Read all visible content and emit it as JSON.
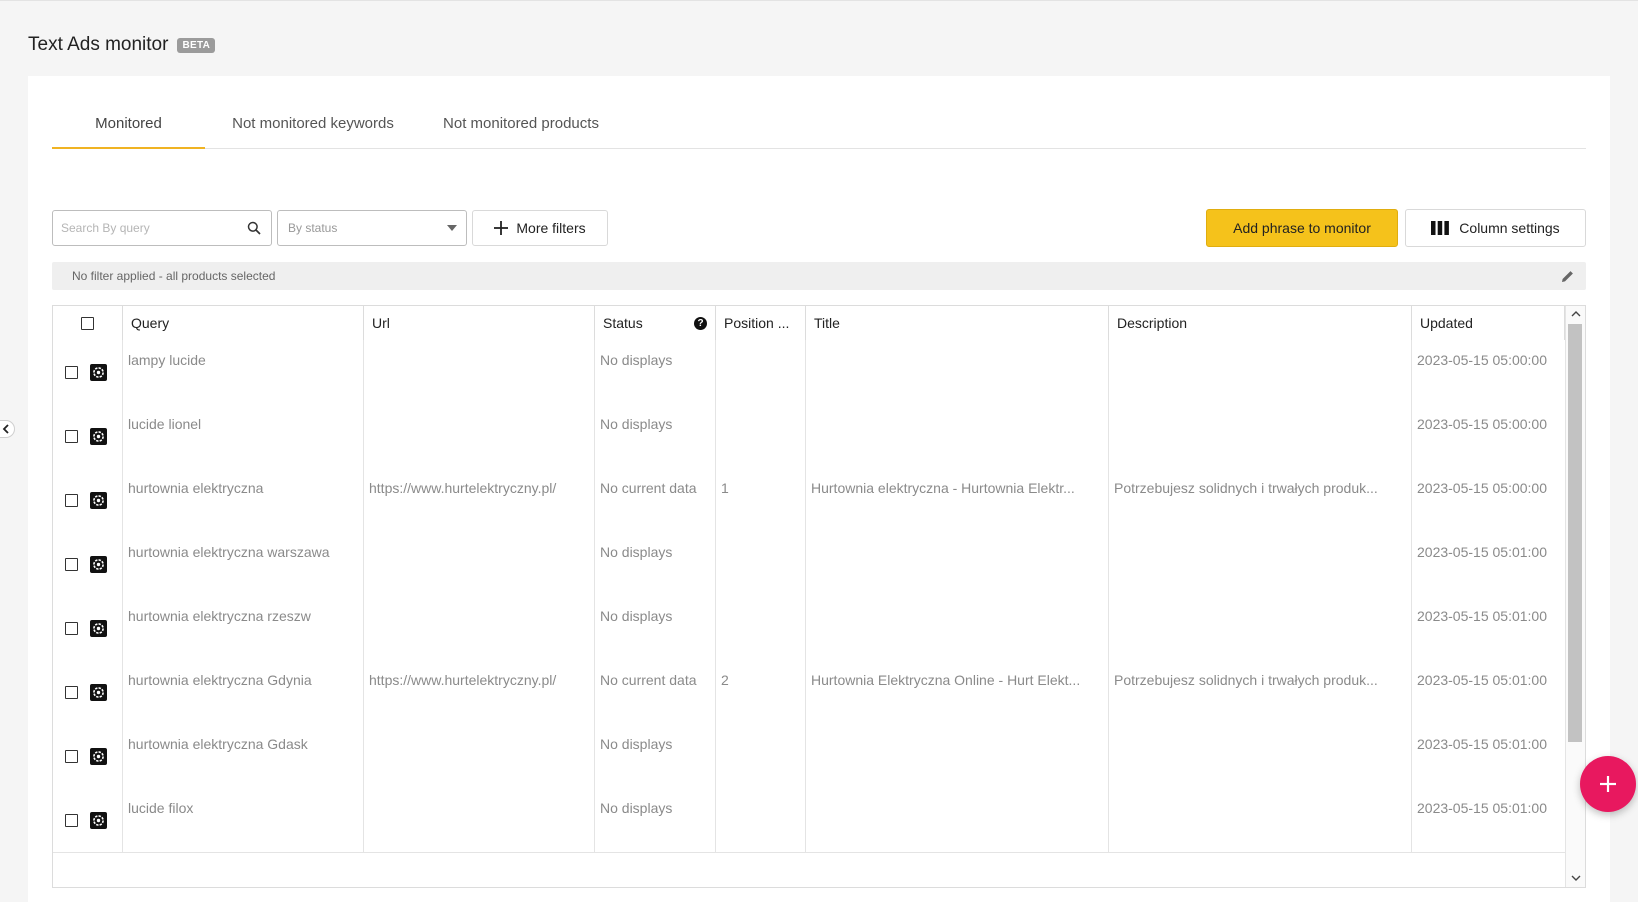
{
  "page": {
    "title": "Text Ads monitor",
    "badge": "BETA"
  },
  "tabs": [
    {
      "label": "Monitored",
      "active": true
    },
    {
      "label": "Not monitored keywords",
      "active": false
    },
    {
      "label": "Not monitored products",
      "active": false
    }
  ],
  "toolbar": {
    "search_placeholder": "Search By query",
    "status_placeholder": "By status",
    "more_filters_label": "More filters",
    "add_phrase_label": "Add phrase to monitor",
    "column_settings_label": "Column settings"
  },
  "filter_bar": {
    "text": "No filter applied - all products selected"
  },
  "table": {
    "columns": [
      "Query",
      "Url",
      "Status",
      "Position ...",
      "Title",
      "Description",
      "Updated"
    ],
    "rows": [
      {
        "query": "lampy lucide",
        "url": "",
        "status": "No displays",
        "position": "",
        "title": "",
        "description": "",
        "updated": "2023-05-15 05:00:00"
      },
      {
        "query": "lucide lionel",
        "url": "",
        "status": "No displays",
        "position": "",
        "title": "",
        "description": "",
        "updated": "2023-05-15 05:00:00"
      },
      {
        "query": "hurtownia elektryczna",
        "url": "https://www.hurtelektryczny.pl/",
        "status": "No current data",
        "position": "1",
        "title": "Hurtownia elektryczna - Hurtownia Elektr...",
        "description": "Potrzebujesz solidnych i trwałych produk...",
        "updated": "2023-05-15 05:00:00"
      },
      {
        "query": "hurtownia elektryczna warszawa",
        "url": "",
        "status": "No displays",
        "position": "",
        "title": "",
        "description": "",
        "updated": "2023-05-15 05:01:00"
      },
      {
        "query": "hurtownia elektryczna rzeszw",
        "url": "",
        "status": "No displays",
        "position": "",
        "title": "",
        "description": "",
        "updated": "2023-05-15 05:01:00"
      },
      {
        "query": "hurtownia elektryczna Gdynia",
        "url": "https://www.hurtelektryczny.pl/",
        "status": "No current data",
        "position": "2",
        "title": "Hurtownia Elektryczna Online - Hurt Elekt...",
        "description": "Potrzebujesz solidnych i trwałych produk...",
        "updated": "2023-05-15 05:01:00"
      },
      {
        "query": "hurtownia elektryczna Gdask",
        "url": "",
        "status": "No displays",
        "position": "",
        "title": "",
        "description": "",
        "updated": "2023-05-15 05:01:00"
      },
      {
        "query": "lucide filox",
        "url": "",
        "status": "No displays",
        "position": "",
        "title": "",
        "description": "",
        "updated": "2023-05-15 05:01:00"
      }
    ]
  },
  "colors": {
    "accent": "#f5c21b",
    "tab_underline": "#f0b323",
    "fab": "#e8185f"
  },
  "icons": {
    "search": "search-icon",
    "dropdown": "chevron-down-icon",
    "plus": "plus-icon",
    "columns": "columns-icon",
    "edit": "pencil-icon",
    "gear": "gear-icon",
    "help": "help-icon",
    "collapse": "chevron-left-icon"
  }
}
